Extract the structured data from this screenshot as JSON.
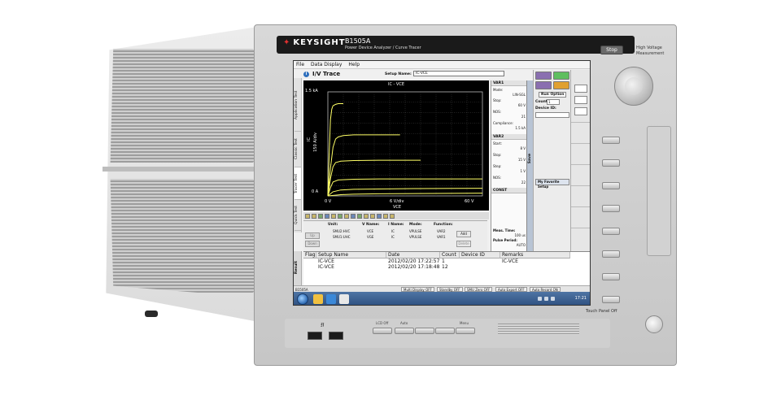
{
  "device": {
    "brand": "KEYSIGHT",
    "model": "B1505A",
    "model_subtitle": "Power Device Analyzer / Curve Tracer",
    "stop_label": "Stop",
    "hv_label": "High Voltage Measurement",
    "touch_panel_label": "Touch Panel Off",
    "usb_icon": "usb-icon",
    "front_keys": [
      "LCD Off",
      "Auto",
      "",
      "",
      "Menu"
    ]
  },
  "menu": [
    "File",
    "Data Display",
    "Help"
  ],
  "window": {
    "title": "I/V Trace",
    "setup_name_label": "Setup Name:",
    "setup_name_value": "IC-VCE"
  },
  "left_tabs": [
    "Quick Test",
    "Tracer Test",
    "Classic Test",
    "Application Test"
  ],
  "chart_data": {
    "type": "line",
    "title": "IC - VCE",
    "xlabel": "VCE",
    "ylabel": "IC",
    "x_tick_labels": [
      "0 V",
      "6 V/div",
      "60 V"
    ],
    "y_tick_labels": [
      "1.5 kA",
      "150 A/div",
      "0 A"
    ],
    "xlim": [
      0,
      60
    ],
    "ylim": [
      0,
      1500
    ],
    "grid": true,
    "series_color": "#ffff66",
    "series": [
      {
        "x": [
          0,
          0.5,
          1,
          1.5,
          2,
          3,
          4,
          6
        ],
        "y": [
          0,
          600,
          1100,
          1250,
          1300,
          1320,
          1330,
          1330
        ]
      },
      {
        "x": [
          0,
          1,
          2,
          3,
          4,
          6,
          10,
          20,
          28
        ],
        "y": [
          0,
          400,
          700,
          820,
          850,
          870,
          880,
          880,
          880
        ]
      },
      {
        "x": [
          0,
          1,
          2,
          3,
          5,
          10,
          20,
          30,
          36
        ],
        "y": [
          0,
          250,
          420,
          480,
          500,
          510,
          515,
          515,
          515
        ]
      },
      {
        "x": [
          0,
          1,
          2,
          4,
          10,
          20,
          35,
          50,
          60
        ],
        "y": [
          0,
          120,
          200,
          230,
          240,
          245,
          245,
          245,
          245
        ]
      },
      {
        "x": [
          0,
          2,
          5,
          10,
          20,
          35,
          50,
          60
        ],
        "y": [
          0,
          60,
          85,
          95,
          100,
          105,
          108,
          110
        ]
      },
      {
        "x": [
          0,
          5,
          10,
          20,
          40,
          60
        ],
        "y": [
          0,
          18,
          25,
          30,
          35,
          40
        ]
      }
    ]
  },
  "var_panel": {
    "var1": {
      "header": "VAR1",
      "rows": [
        {
          "label": "Mode:",
          "value": "LIN-SGL"
        },
        {
          "label": "Stop:",
          "value": "60 V"
        },
        {
          "label": "NOS:",
          "value": "21"
        },
        {
          "label": "Compliance:",
          "value": "1.5 kA"
        }
      ]
    },
    "var2": {
      "header": "VAR2",
      "rows": [
        {
          "label": "Start:",
          "value": "8 V"
        },
        {
          "label": "Stop:",
          "value": "15 V"
        },
        {
          "label": "Step:",
          "value": "1 V"
        },
        {
          "label": "NOS:",
          "value": "22"
        }
      ]
    },
    "const": {
      "header": "CONST"
    },
    "save_label": "Save"
  },
  "smu_panel": {
    "headers": [
      "Unit:",
      "V Name:",
      "I Name:",
      "Mode:",
      "Function:"
    ],
    "rows": [
      {
        "unit": "SMU2:HVC",
        "vname": "VCE",
        "iname": "IC",
        "mode": "VPULSE",
        "function": "VAR2"
      },
      {
        "unit": "SMU1:UHC",
        "vname": "VGE",
        "iname": "IC",
        "mode": "VPULSE",
        "function": "VAR1"
      }
    ],
    "up_label": "Up",
    "down_label": "Down",
    "add_label": "Add",
    "delete_label": "Delete",
    "meas_time_label": "Meas. Time:",
    "meas_time_value": "100 us",
    "pulse_period_label": "Pulse Period:",
    "pulse_period_value": "AUTO"
  },
  "right_panel": {
    "run_option_label": "Run Option",
    "count_label": "Count:",
    "count_value": "1",
    "device_id_label": "Device ID:",
    "favorite_label": "My Favorite Setup"
  },
  "results": {
    "tab_label": "Result",
    "columns": [
      "Flag",
      "Setup Name",
      "Date",
      "Count",
      "Device ID",
      "Remarks"
    ],
    "rows": [
      {
        "flag": "",
        "setup": "IC-VCE",
        "date": "2012/02/20 17:22:57",
        "count": "1",
        "device": "",
        "remarks": "IC-VCE"
      },
      {
        "flag": "",
        "setup": "IC-VCE",
        "date": "2012/02/20 17:18:48",
        "count": "12",
        "device": "",
        "remarks": ""
      }
    ]
  },
  "status_bar": {
    "left": "B1505A",
    "items": [
      "Multi Display OFF",
      "Standby OFF",
      "SMU Zero OFF",
      "Auto Export OFF",
      "Auto Record ON"
    ]
  },
  "taskbar": {
    "clock": "17:21"
  }
}
